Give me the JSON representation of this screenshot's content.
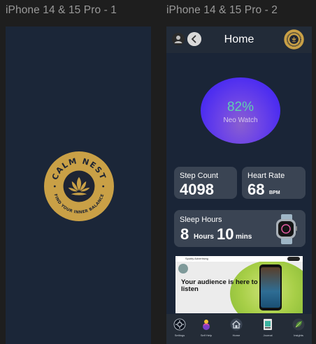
{
  "frames": [
    {
      "label": "iPhone 14 & 15 Pro - 1"
    },
    {
      "label": "iPhone 14 & 15 Pro - 2"
    }
  ],
  "logo": {
    "brand": "CALM NEST",
    "tagline": "FIND YOUR INNER BALANCE",
    "colors": {
      "gold": "#c9a046",
      "dark": "#1e2433"
    }
  },
  "home": {
    "title": "Home",
    "ring": {
      "value": "82%",
      "label": "Neo Watch",
      "color": "#4e2ef0"
    },
    "step_count": {
      "title": "Step Count",
      "value": "4098"
    },
    "heart_rate": {
      "title": "Heart Rate",
      "value": "68",
      "unit": "BPM"
    },
    "sleep": {
      "title": "Sleep Hours",
      "hours": "8",
      "hours_unit": "Hours",
      "mins": "10",
      "mins_unit": "mins"
    },
    "ad": {
      "headline": "Your audience is here to listen",
      "brand": "Spotify Advertising"
    },
    "tabs": [
      {
        "label": "Settings",
        "icon": "settings-icon"
      },
      {
        "label": "Self Help",
        "icon": "self-help-icon"
      },
      {
        "label": "Home",
        "icon": "home-icon"
      },
      {
        "label": "Journal",
        "icon": "journal-icon"
      },
      {
        "label": "Insights",
        "icon": "insights-icon"
      }
    ]
  }
}
